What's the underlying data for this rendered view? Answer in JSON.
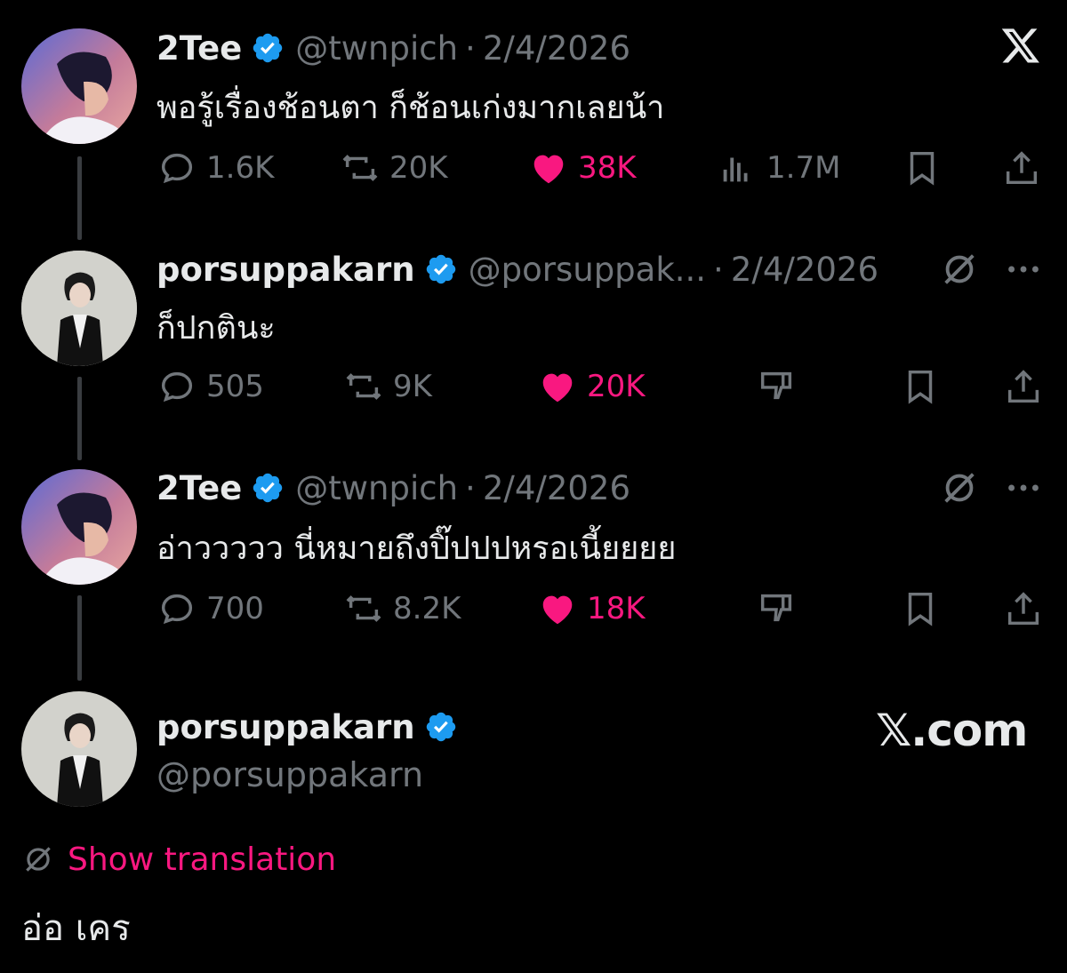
{
  "tweets": [
    {
      "name": "2Tee",
      "handle": "@twnpich",
      "date": "2/4/2026",
      "text": "พอรู้เรื่องช้อนตา ก็ช้อนเก่งมากเลยน้า",
      "replies": "1.6K",
      "retweets": "20K",
      "likes": "38K",
      "views": "1.7M"
    },
    {
      "name": "porsuppakarn",
      "handle": "@porsuppak...",
      "date": "2/4/2026",
      "text": "ก็ปกตินะ",
      "replies": "505",
      "retweets": "9K",
      "likes": "20K"
    },
    {
      "name": "2Tee",
      "handle": "@twnpich",
      "date": "2/4/2026",
      "text": "อ่าววววว นี่หมายถึงปิ๊ปปปหรอเนี้ยยยย",
      "replies": "700",
      "retweets": "8.2K",
      "likes": "18K"
    }
  ],
  "final": {
    "name": "porsuppakarn",
    "handle": "@porsuppakarn",
    "show_translation": "Show translation",
    "text": "อ่อ เคร"
  },
  "watermark": "𝕏.com",
  "colors": {
    "like": "#f91880",
    "verified": "#1d9bf0",
    "muted": "#71767b",
    "text": "#e7e9ea"
  },
  "icons": [
    "reply-icon",
    "retweet-icon",
    "heart-icon",
    "views-icon",
    "bookmark-icon",
    "share-icon",
    "translate-icon",
    "more-icon",
    "downvote-icon",
    "x-logo-icon",
    "verified-badge-icon"
  ]
}
